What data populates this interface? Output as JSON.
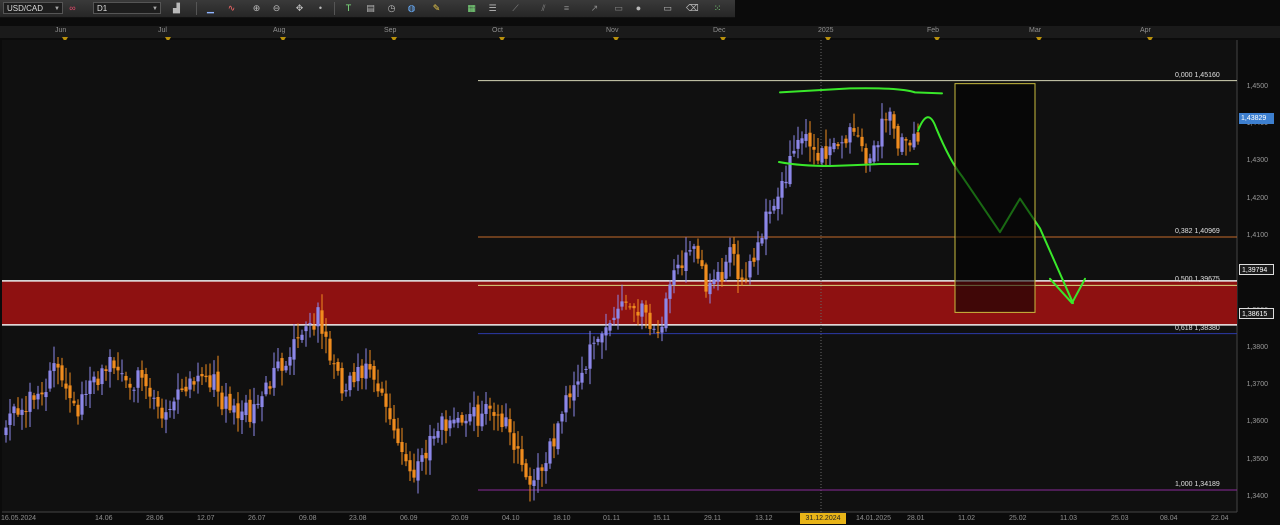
{
  "toolbar": {
    "symbol": "USD/CAD",
    "timeframe": "D1",
    "icons": [
      "chart-type-icon",
      "line-study-icon",
      "zoom-in-icon",
      "zoom-out-icon",
      "crosshair-icon",
      "text-icon",
      "templates-icon",
      "clock-icon",
      "globe-icon",
      "pen-icon",
      "layout-icon",
      "settings-icon",
      "circle-icon",
      "eraser-icon",
      "grid-icon"
    ]
  },
  "colors": {
    "bull": "#8c87e8",
    "bear": "#f08c1e",
    "zone": "#8e1111",
    "hand": "#39e82a",
    "fib_top": "#d4d4b4",
    "fib_382": "#c46a2a",
    "fib_500": "#d8d880",
    "fib_618": "#2b3aa8",
    "fib_100": "#8a2a9a",
    "box": "#c9bb3e"
  },
  "months": [
    "Jun",
    "Jul",
    "Aug",
    "Sep",
    "Oct",
    "Nov",
    "Dec",
    "2025",
    "Feb",
    "Mar",
    "Apr"
  ],
  "chart_data": {
    "type": "candlestick",
    "symbol": "USD/CAD",
    "timeframe": "D1",
    "ylim": [
      1.336,
      1.4625
    ],
    "y_ticks": [
      "1,4500",
      "1,4400",
      "1,4300",
      "1,4200",
      "1,4100",
      "1,4000",
      "1,3900",
      "1,3800",
      "1,3700",
      "1,3600",
      "1,3500",
      "1,3400"
    ],
    "x_ticks": [
      "16.05.2024",
      "14.06",
      "28.06",
      "12.07",
      "26.07",
      "09.08",
      "23.08",
      "06.09",
      "20.09",
      "04.10",
      "18.10",
      "01.11",
      "15.11",
      "29.11",
      "13.12",
      "31.12.2024",
      "14.01.2025",
      "28.01",
      "11.02",
      "25.02",
      "11.03",
      "25.03",
      "08.04",
      "22.04"
    ],
    "highlighted_x": "31.12.2024",
    "price_tags": {
      "last": "1,43829",
      "zone_top": "1,39794",
      "zone_bottom": "1,38615"
    },
    "fibonacci": [
      {
        "label": "0,000 1,45160",
        "level": 0.0,
        "price": 1.4516
      },
      {
        "label": "0,382 1,40969",
        "level": 0.382,
        "price": 1.40969
      },
      {
        "label": "0,500 1,39675",
        "level": 0.5,
        "price": 1.39675
      },
      {
        "label": "0,618 1,38380",
        "level": 0.618,
        "price": 1.3838
      },
      {
        "label": "1,000 1,34189",
        "level": 1.0,
        "price": 1.34189
      }
    ],
    "zone": {
      "top": 1.39794,
      "bottom": 1.38615
    },
    "segments": [
      [
        1.361,
        1.366,
        8
      ],
      [
        1.366,
        1.375,
        6
      ],
      [
        1.375,
        1.364,
        5
      ],
      [
        1.364,
        1.376,
        7
      ],
      [
        1.376,
        1.371,
        8
      ],
      [
        1.371,
        1.362,
        6
      ],
      [
        1.362,
        1.371,
        6
      ],
      [
        1.371,
        1.374,
        5
      ],
      [
        1.374,
        1.364,
        5
      ],
      [
        1.364,
        1.362,
        6
      ],
      [
        1.362,
        1.371,
        5
      ],
      [
        1.371,
        1.385,
        8
      ],
      [
        1.385,
        1.388,
        4
      ],
      [
        1.388,
        1.368,
        6
      ],
      [
        1.368,
        1.374,
        6
      ],
      [
        1.374,
        1.362,
        6
      ],
      [
        1.362,
        1.346,
        5
      ],
      [
        1.346,
        1.357,
        6
      ],
      [
        1.357,
        1.362,
        5
      ],
      [
        1.362,
        1.361,
        4
      ],
      [
        1.361,
        1.364,
        6
      ],
      [
        1.364,
        1.358,
        4
      ],
      [
        1.358,
        1.344,
        5
      ],
      [
        1.344,
        1.352,
        5
      ],
      [
        1.352,
        1.369,
        5
      ],
      [
        1.369,
        1.38,
        6
      ],
      [
        1.38,
        1.393,
        7
      ],
      [
        1.393,
        1.39,
        6
      ],
      [
        1.39,
        1.384,
        3
      ],
      [
        1.384,
        1.398,
        4
      ],
      [
        1.398,
        1.408,
        4
      ],
      [
        1.408,
        1.396,
        4
      ],
      [
        1.396,
        1.398,
        3
      ],
      [
        1.398,
        1.404,
        3
      ],
      [
        1.404,
        1.399,
        3
      ],
      [
        1.399,
        1.405,
        3
      ],
      [
        1.405,
        1.418,
        4
      ],
      [
        1.418,
        1.425,
        4
      ],
      [
        1.425,
        1.436,
        3
      ],
      [
        1.436,
        1.432,
        6
      ],
      [
        1.432,
        1.438,
        8
      ],
      [
        1.438,
        1.43,
        4
      ],
      [
        1.43,
        1.446,
        5
      ],
      [
        1.446,
        1.432,
        2
      ],
      [
        1.432,
        1.437,
        3
      ],
      [
        1.437,
        1.436,
        2
      ]
    ],
    "handdrawn_channel": {
      "upper": 1.449,
      "lower": 1.429
    },
    "projection_box": {
      "top": 1.4508,
      "bottom": 1.3895
    }
  }
}
